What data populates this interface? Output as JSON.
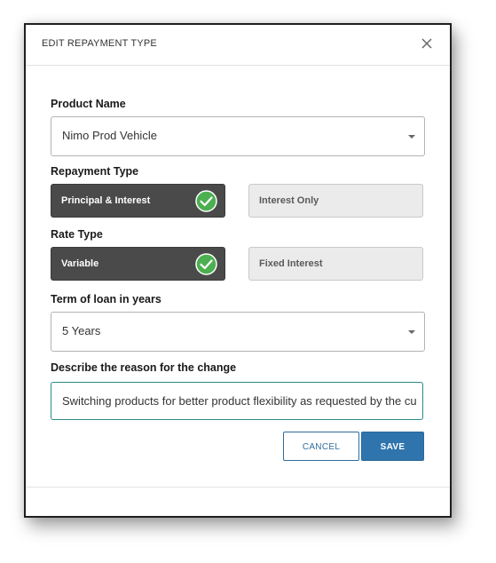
{
  "dialog": {
    "title": "EDIT REPAYMENT TYPE",
    "close_icon": "close-icon"
  },
  "product": {
    "label": "Product Name",
    "value": "Nimo Prod Vehicle"
  },
  "repayment_type": {
    "label": "Repayment Type",
    "options": [
      {
        "label": "Principal & Interest",
        "selected": true
      },
      {
        "label": "Interest Only",
        "selected": false
      }
    ]
  },
  "rate_type": {
    "label": "Rate Type",
    "options": [
      {
        "label": "Variable",
        "selected": true
      },
      {
        "label": "Fixed Interest",
        "selected": false
      }
    ]
  },
  "term": {
    "label": "Term of loan in years",
    "value": "5 Years"
  },
  "reason": {
    "label": "Describe the reason for the change",
    "value": "Switching products for better product flexibility as requested by the cu"
  },
  "actions": {
    "cancel_label": "CANCEL",
    "save_label": "SAVE"
  },
  "colors": {
    "selected_bg": "#4a4a4a",
    "check_green": "#4caf50",
    "primary": "#2f74ad",
    "focus_border": "#2a8a8a"
  }
}
